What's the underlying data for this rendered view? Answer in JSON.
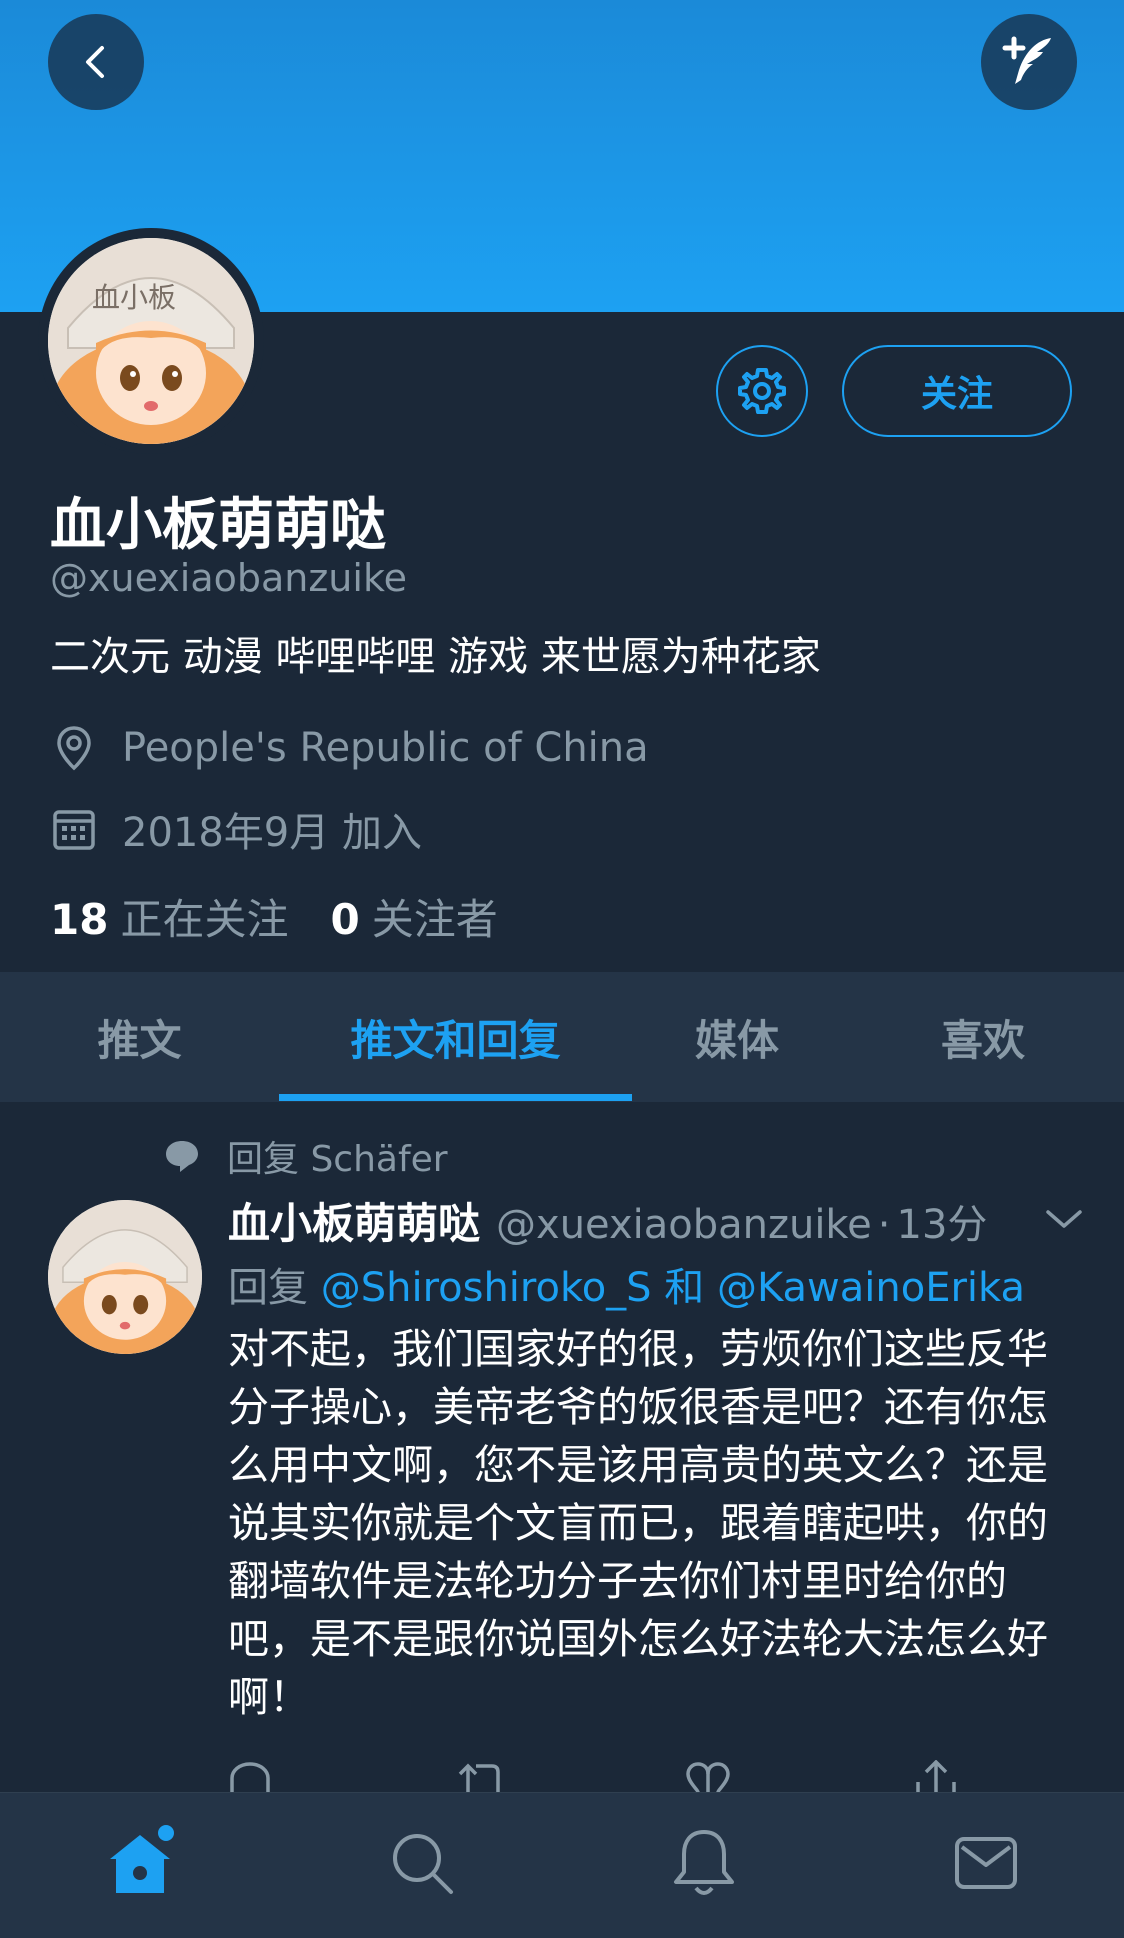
{
  "colors": {
    "accent": "#1da1f2",
    "background": "#1b2838",
    "secondary_text": "#8899a6",
    "tab_bar": "#243447"
  },
  "header": {
    "back_icon": "back-chevron-icon",
    "compose_icon": "compose-tweet-icon"
  },
  "avatar": {
    "cap_text": "血小板"
  },
  "profile": {
    "name": "血小板萌萌哒",
    "handle": "@xuexiaobanzuike",
    "bio": "二次元 动漫 哔哩哔哩 游戏 来世愿为种花家",
    "location": "People's Republic of China",
    "joined": "2018年9月 加入",
    "following_count": "18",
    "following_label": "正在关注",
    "followers_count": "0",
    "followers_label": "关注者",
    "follow_button": "关注",
    "settings_icon": "gear-icon"
  },
  "tabs": [
    {
      "label": "推文"
    },
    {
      "label": "推文和回复",
      "active": true
    },
    {
      "label": "媒体"
    },
    {
      "label": "喜欢"
    }
  ],
  "tweet": {
    "reply_context": "回复 Schäfer",
    "author_name": "血小板萌萌哒",
    "author_handle": "@xuexiaobanzuike",
    "separator": "·",
    "time": "13分",
    "reply_prefix": "回复",
    "mention_1": "@Shiroshiroko_S",
    "and_word": "和",
    "mention_2": "@KawainoErika",
    "body": "对不起，我们国家好的很，劳烦你们这些反华分子操心，美帝老爷的饭很香是吧？还有你怎么用中文啊，您不是该用高贵的英文么？还是说其实你就是个文盲而已，跟着瞎起哄，你的翻墙软件是法轮功分子去你们村里时给你的吧，是不是跟你说国外怎么好法轮大法怎么好啊！"
  },
  "bottom_nav": [
    {
      "icon": "home-icon",
      "active": true
    },
    {
      "icon": "search-icon"
    },
    {
      "icon": "notifications-bell-icon"
    },
    {
      "icon": "messages-envelope-icon"
    }
  ]
}
